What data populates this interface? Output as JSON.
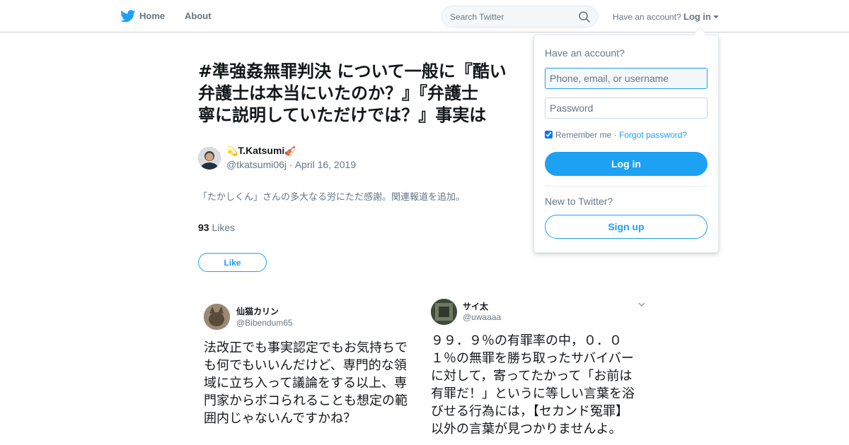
{
  "nav": {
    "home_label": "Home",
    "about_label": "About",
    "search_placeholder": "Search Twitter",
    "account_question": "Have an account?",
    "login_label": "Log in"
  },
  "tweet": {
    "text_lines": [
      "#準強姦無罪判決 について一般に『酷い",
      "弁護士は本当にいたのか？』『弁護士",
      "寧に説明していただけでは？』事実は"
    ],
    "author_name": "T.Katsumi",
    "author_emoji_left": "💫",
    "author_emoji_right": "🎻",
    "author_handle": "@tkatsumi06j",
    "separator": "·",
    "date": "April 16, 2019",
    "subtext": "「たかしくん」さんの多大なる労にただ感謝。関連報道を追加。",
    "likes_count": "93",
    "likes_label": "Likes",
    "like_button": "Like"
  },
  "embeds": [
    {
      "name": "仙猫カリン",
      "handle": "@Bibendum65",
      "lines": [
        "法改正でも事実認定でもお気持ちで",
        "も何でもいいんだけど、専門的な領",
        "域に立ち入って議論をする以上、専",
        "門家からボコられることも想定の範",
        "囲内じゃないんですかね？"
      ]
    },
    {
      "name": "サイ太",
      "handle": "@uwaaaa",
      "lines": [
        "９９．９％の有罪率の中，０．０",
        "１％の無罪を勝ち取ったサバイバー",
        "に対して，寄ってたかって「お前は",
        "有罪だ！」というに等しい言葉を浴",
        "びせる行為には，【セカンド冤罪】",
        "以外の言葉が見つかりませんよ。"
      ]
    }
  ],
  "login_dropdown": {
    "title": "Have an account?",
    "user_placeholder": "Phone, email, or username",
    "password_placeholder": "Password",
    "remember_label": "Remember me",
    "separator": "·",
    "forgot_label": "Forgot password?",
    "login_button": "Log in",
    "new_to": "New to Twitter?",
    "signup_button": "Sign up"
  },
  "colors": {
    "brand_blue": "#1da1f2",
    "muted_text": "#657786"
  }
}
